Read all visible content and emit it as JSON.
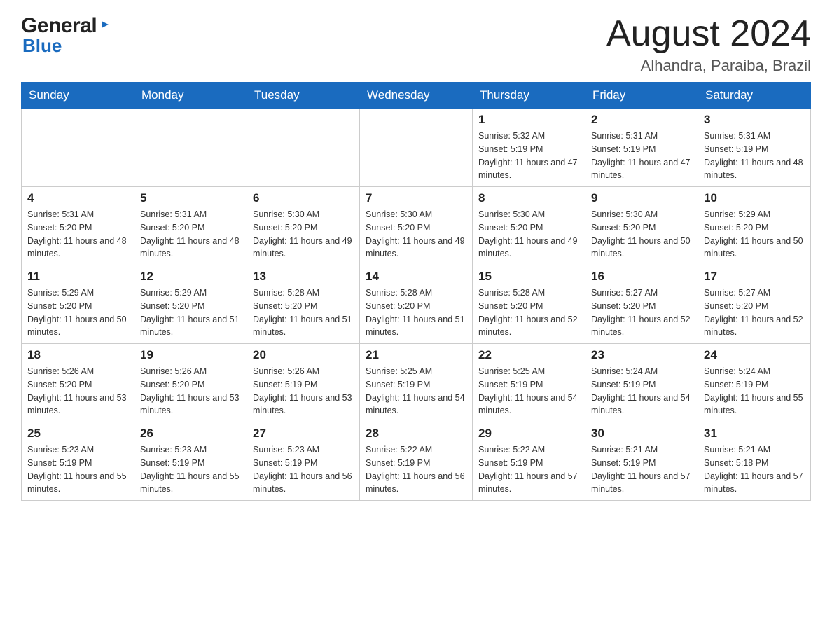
{
  "header": {
    "logo": {
      "general": "General",
      "blue": "Blue"
    },
    "title": "August 2024",
    "location": "Alhandra, Paraiba, Brazil"
  },
  "calendar": {
    "days_of_week": [
      "Sunday",
      "Monday",
      "Tuesday",
      "Wednesday",
      "Thursday",
      "Friday",
      "Saturday"
    ],
    "weeks": [
      [
        {
          "day": "",
          "info": ""
        },
        {
          "day": "",
          "info": ""
        },
        {
          "day": "",
          "info": ""
        },
        {
          "day": "",
          "info": ""
        },
        {
          "day": "1",
          "info": "Sunrise: 5:32 AM\nSunset: 5:19 PM\nDaylight: 11 hours and 47 minutes."
        },
        {
          "day": "2",
          "info": "Sunrise: 5:31 AM\nSunset: 5:19 PM\nDaylight: 11 hours and 47 minutes."
        },
        {
          "day": "3",
          "info": "Sunrise: 5:31 AM\nSunset: 5:19 PM\nDaylight: 11 hours and 48 minutes."
        }
      ],
      [
        {
          "day": "4",
          "info": "Sunrise: 5:31 AM\nSunset: 5:20 PM\nDaylight: 11 hours and 48 minutes."
        },
        {
          "day": "5",
          "info": "Sunrise: 5:31 AM\nSunset: 5:20 PM\nDaylight: 11 hours and 48 minutes."
        },
        {
          "day": "6",
          "info": "Sunrise: 5:30 AM\nSunset: 5:20 PM\nDaylight: 11 hours and 49 minutes."
        },
        {
          "day": "7",
          "info": "Sunrise: 5:30 AM\nSunset: 5:20 PM\nDaylight: 11 hours and 49 minutes."
        },
        {
          "day": "8",
          "info": "Sunrise: 5:30 AM\nSunset: 5:20 PM\nDaylight: 11 hours and 49 minutes."
        },
        {
          "day": "9",
          "info": "Sunrise: 5:30 AM\nSunset: 5:20 PM\nDaylight: 11 hours and 50 minutes."
        },
        {
          "day": "10",
          "info": "Sunrise: 5:29 AM\nSunset: 5:20 PM\nDaylight: 11 hours and 50 minutes."
        }
      ],
      [
        {
          "day": "11",
          "info": "Sunrise: 5:29 AM\nSunset: 5:20 PM\nDaylight: 11 hours and 50 minutes."
        },
        {
          "day": "12",
          "info": "Sunrise: 5:29 AM\nSunset: 5:20 PM\nDaylight: 11 hours and 51 minutes."
        },
        {
          "day": "13",
          "info": "Sunrise: 5:28 AM\nSunset: 5:20 PM\nDaylight: 11 hours and 51 minutes."
        },
        {
          "day": "14",
          "info": "Sunrise: 5:28 AM\nSunset: 5:20 PM\nDaylight: 11 hours and 51 minutes."
        },
        {
          "day": "15",
          "info": "Sunrise: 5:28 AM\nSunset: 5:20 PM\nDaylight: 11 hours and 52 minutes."
        },
        {
          "day": "16",
          "info": "Sunrise: 5:27 AM\nSunset: 5:20 PM\nDaylight: 11 hours and 52 minutes."
        },
        {
          "day": "17",
          "info": "Sunrise: 5:27 AM\nSunset: 5:20 PM\nDaylight: 11 hours and 52 minutes."
        }
      ],
      [
        {
          "day": "18",
          "info": "Sunrise: 5:26 AM\nSunset: 5:20 PM\nDaylight: 11 hours and 53 minutes."
        },
        {
          "day": "19",
          "info": "Sunrise: 5:26 AM\nSunset: 5:20 PM\nDaylight: 11 hours and 53 minutes."
        },
        {
          "day": "20",
          "info": "Sunrise: 5:26 AM\nSunset: 5:19 PM\nDaylight: 11 hours and 53 minutes."
        },
        {
          "day": "21",
          "info": "Sunrise: 5:25 AM\nSunset: 5:19 PM\nDaylight: 11 hours and 54 minutes."
        },
        {
          "day": "22",
          "info": "Sunrise: 5:25 AM\nSunset: 5:19 PM\nDaylight: 11 hours and 54 minutes."
        },
        {
          "day": "23",
          "info": "Sunrise: 5:24 AM\nSunset: 5:19 PM\nDaylight: 11 hours and 54 minutes."
        },
        {
          "day": "24",
          "info": "Sunrise: 5:24 AM\nSunset: 5:19 PM\nDaylight: 11 hours and 55 minutes."
        }
      ],
      [
        {
          "day": "25",
          "info": "Sunrise: 5:23 AM\nSunset: 5:19 PM\nDaylight: 11 hours and 55 minutes."
        },
        {
          "day": "26",
          "info": "Sunrise: 5:23 AM\nSunset: 5:19 PM\nDaylight: 11 hours and 55 minutes."
        },
        {
          "day": "27",
          "info": "Sunrise: 5:23 AM\nSunset: 5:19 PM\nDaylight: 11 hours and 56 minutes."
        },
        {
          "day": "28",
          "info": "Sunrise: 5:22 AM\nSunset: 5:19 PM\nDaylight: 11 hours and 56 minutes."
        },
        {
          "day": "29",
          "info": "Sunrise: 5:22 AM\nSunset: 5:19 PM\nDaylight: 11 hours and 57 minutes."
        },
        {
          "day": "30",
          "info": "Sunrise: 5:21 AM\nSunset: 5:19 PM\nDaylight: 11 hours and 57 minutes."
        },
        {
          "day": "31",
          "info": "Sunrise: 5:21 AM\nSunset: 5:18 PM\nDaylight: 11 hours and 57 minutes."
        }
      ]
    ]
  },
  "colors": {
    "header_bg": "#1a6bbf",
    "header_text": "#ffffff",
    "logo_blue": "#1a6bbf"
  }
}
